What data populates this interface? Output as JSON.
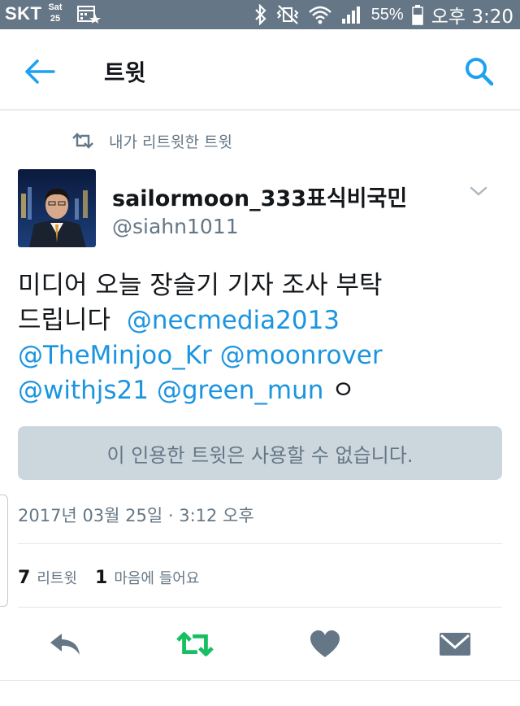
{
  "status_bar": {
    "carrier": "SKT",
    "day": "Sat",
    "date": "25",
    "battery": "55%",
    "time": "오후 3:20"
  },
  "app_bar": {
    "title": "트윗",
    "back_icon": "arrow-left-icon",
    "search_icon": "search-icon"
  },
  "tweet": {
    "retweet_context": "내가 리트윗한 트윗",
    "display_name": "sailormoon_333표식비국민",
    "username": "@siahn1011",
    "text_plain_1": "미디어 오늘 장슬기 기자 조사 부탁",
    "text_plain_2": "드립니다",
    "mention_1": "@necmedia2013",
    "mention_2": "@TheMinjoo_Kr",
    "mention_3": "@moonrover",
    "mention_4": "@withjs21",
    "mention_5": "@green_mun",
    "text_trailing": "ㅇ",
    "quote_unavailable": "이 인용한 트윗은 사용할 수 없습니다.",
    "timestamp": "2017년 03월 25일 · 3:12 오후",
    "retweet_count": "7",
    "retweet_label": "리트윗",
    "like_count": "1",
    "like_label": "마음에 들어요"
  },
  "actions": {
    "reply_icon": "reply-icon",
    "retweet_icon": "retweet-icon",
    "like_icon": "heart-icon",
    "dm_icon": "envelope-icon"
  },
  "colors": {
    "status_bar": "#657786",
    "accent": "#1da1f2",
    "mention": "#1b95e0",
    "retweet_active": "#17bf63",
    "secondary_text": "#657786",
    "quote_bg": "#ccd6dd"
  }
}
